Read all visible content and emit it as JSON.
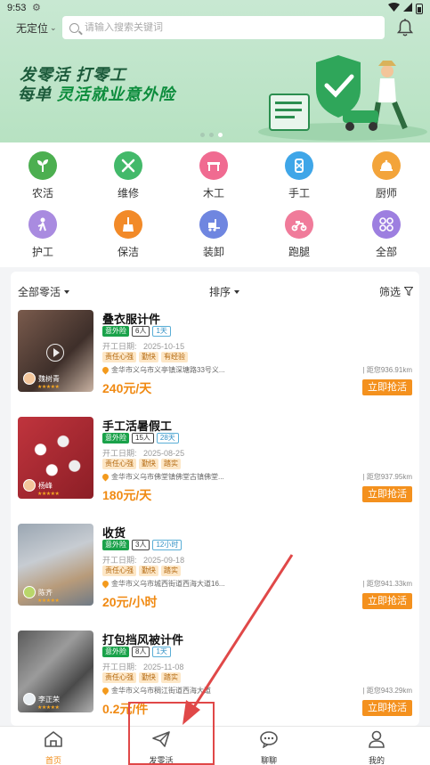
{
  "status_bar": {
    "time": "9:53"
  },
  "header": {
    "location": "无定位",
    "search_placeholder": "请输入搜索关键词"
  },
  "banner": {
    "line1": "发零活  打零工",
    "line2_prefix": "每单 ",
    "line2_highlight": "灵活就业意外险",
    "active_dot": 2
  },
  "categories": [
    {
      "label": "农活",
      "icon": "plant-icon",
      "color": "#4caf50"
    },
    {
      "label": "维修",
      "icon": "tools-icon",
      "color": "#43b96a"
    },
    {
      "label": "木工",
      "icon": "bench-icon",
      "color": "#f06b91"
    },
    {
      "label": "手工",
      "icon": "craft-icon",
      "color": "#3fa6e8"
    },
    {
      "label": "厨师",
      "icon": "cloche-icon",
      "color": "#f3a43a"
    },
    {
      "label": "护工",
      "icon": "nurse-icon",
      "color": "#a98be0"
    },
    {
      "label": "保洁",
      "icon": "broom-icon",
      "color": "#f28a28"
    },
    {
      "label": "装卸",
      "icon": "forklift-icon",
      "color": "#6f86e0"
    },
    {
      "label": "跑腿",
      "icon": "scooter-icon",
      "color": "#f07b9a"
    },
    {
      "label": "全部",
      "icon": "grid-icon",
      "color": "#9d7fe0"
    }
  ],
  "filters": {
    "all": "全部零活",
    "sort": "排序",
    "filter": "筛选"
  },
  "jobs": [
    {
      "title": "叠衣服计件",
      "badge": "意外险",
      "people": "6人",
      "days": "1天",
      "date_label": "开工日期:",
      "date": "2025-10-15",
      "tags": [
        "责任心强",
        "勤快",
        "有经验"
      ],
      "address": "金华市义乌市义亭镇深塘路33号义...",
      "distance": "| 距您936.91km",
      "price": "240元/天",
      "poster": "魏树青",
      "grab": "立即抢活"
    },
    {
      "title": "手工活暑假工",
      "badge": "意外险",
      "people": "15人",
      "days": "28天",
      "date_label": "开工日期:",
      "date": "2025-08-25",
      "tags": [
        "责任心强",
        "勤快",
        "踏实"
      ],
      "address": "金华市义乌市佛堂镇佛堂古镇佛堂...",
      "distance": "| 距您937.95km",
      "price": "180元/天",
      "poster": "杨峰",
      "grab": "立即抢活"
    },
    {
      "title": "收货",
      "badge": "意外险",
      "people": "3人",
      "days": "12小时",
      "date_label": "开工日期:",
      "date": "2025-09-18",
      "tags": [
        "责任心强",
        "勤快",
        "踏实"
      ],
      "address": "金华市义乌市城西街道西海大道16...",
      "distance": "| 距您941.33km",
      "price": "20元/小时",
      "poster": "陈齐",
      "grab": "立即抢活"
    },
    {
      "title": "打包挡风被计件",
      "badge": "意外险",
      "people": "8人",
      "days": "1天",
      "date_label": "开工日期:",
      "date": "2025-11-08",
      "tags": [
        "责任心强",
        "勤快",
        "踏实"
      ],
      "address": "金华市义乌市稠江街道西海大道",
      "distance": "| 距您943.29km",
      "price": "0.2元/件",
      "poster": "李正荣",
      "grab": "立即抢活"
    }
  ],
  "nav": [
    {
      "label": "首页",
      "icon": "home-icon",
      "active": true
    },
    {
      "label": "发零活",
      "icon": "send-icon",
      "active": false
    },
    {
      "label": "聊聊",
      "icon": "chat-icon",
      "active": false
    },
    {
      "label": "我的",
      "icon": "user-icon",
      "active": false
    }
  ]
}
